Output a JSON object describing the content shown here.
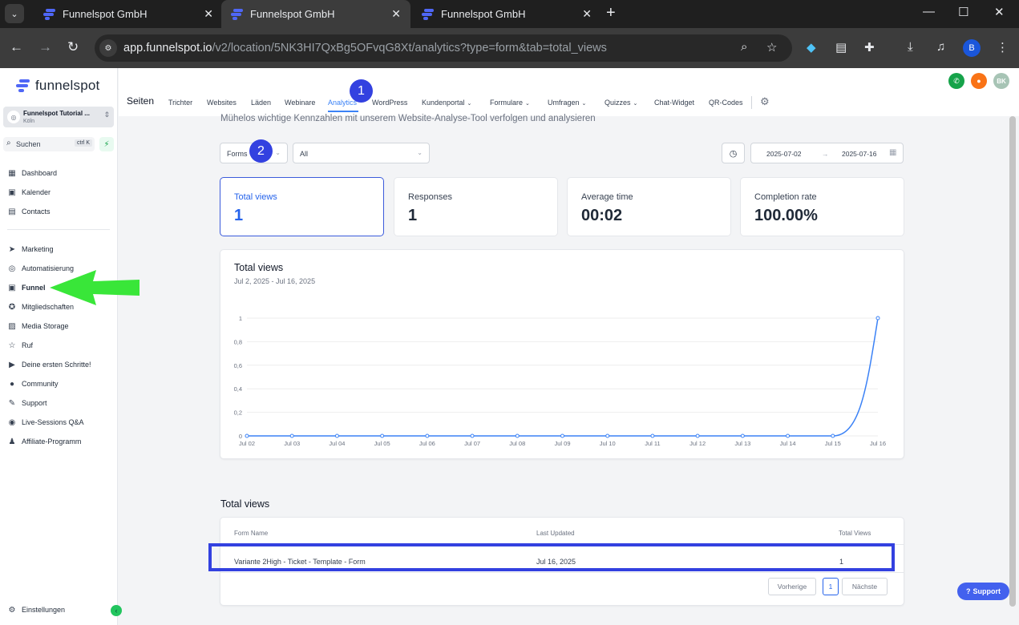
{
  "browser": {
    "tabs": [
      {
        "title": "Funnelspot GmbH",
        "active": false
      },
      {
        "title": "Funnelspot GmbH",
        "active": true
      },
      {
        "title": "Funnelspot GmbH",
        "active": false
      }
    ],
    "url_host": "app.funnelspot.io",
    "url_path": "/v2/location/5NK3HI7QxBg5OFvqG8Xt/analytics?type=form&tab=total_views",
    "profile_initial": "B"
  },
  "sidebar": {
    "brand": "funnelspot",
    "account_name": "Funnelspot Tutorial ...",
    "account_city": "Köln",
    "search_placeholder": "Suchen",
    "search_shortcut": "ctrl K",
    "items_top": [
      {
        "label": "Dashboard",
        "icon": "dashboard-icon",
        "glyph": "▦"
      },
      {
        "label": "Kalender",
        "icon": "calendar-icon",
        "glyph": "▣"
      },
      {
        "label": "Contacts",
        "icon": "contacts-icon",
        "glyph": "▤"
      }
    ],
    "items_main": [
      {
        "label": "Marketing",
        "icon": "send-icon",
        "glyph": "➤"
      },
      {
        "label": "Automatisierung",
        "icon": "automation-icon",
        "glyph": "◎"
      },
      {
        "label": "Funnel",
        "icon": "funnel-icon",
        "glyph": "▣",
        "active": true
      },
      {
        "label": "Mitgliedschaften",
        "icon": "membership-icon",
        "glyph": "✪"
      },
      {
        "label": "Media Storage",
        "icon": "media-icon",
        "glyph": "▨"
      },
      {
        "label": "Ruf",
        "icon": "star-icon",
        "glyph": "☆"
      },
      {
        "label": "Deine ersten Schritte!",
        "icon": "play-icon",
        "glyph": "▶"
      },
      {
        "label": "Community",
        "icon": "community-icon",
        "glyph": "●"
      },
      {
        "label": "Support",
        "icon": "wrench-icon",
        "glyph": "✎"
      },
      {
        "label": "Live-Sessions Q&A",
        "icon": "chat-icon",
        "glyph": "◉"
      },
      {
        "label": "Affiliate-Programm",
        "icon": "affiliate-icon",
        "glyph": "♟"
      }
    ],
    "settings_label": "Einstellungen"
  },
  "topnav": {
    "title": "Seiten",
    "tabs": [
      {
        "label": "Trichter",
        "dropdown": false
      },
      {
        "label": "Websites",
        "dropdown": false
      },
      {
        "label": "Läden",
        "dropdown": false
      },
      {
        "label": "Webinare",
        "dropdown": false
      },
      {
        "label": "Analytics",
        "dropdown": false,
        "active": true
      },
      {
        "label": "WordPress",
        "dropdown": false
      },
      {
        "label": "Kundenportal",
        "dropdown": true
      },
      {
        "label": "Formulare",
        "dropdown": true
      },
      {
        "label": "Umfragen",
        "dropdown": true
      },
      {
        "label": "Quizzes",
        "dropdown": true
      },
      {
        "label": "Chat-Widget",
        "dropdown": false
      },
      {
        "label": "QR-Codes",
        "dropdown": false
      }
    ],
    "user_initials": "BK"
  },
  "markers": [
    "1",
    "2"
  ],
  "analytics": {
    "subtitle": "Mühelos wichtige Kennzahlen mit unserem Website-Analyse-Tool verfolgen und analysieren",
    "type_select": "Forms",
    "filter_select": "All",
    "date_from": "2025-07-02",
    "date_to": "2025-07-16",
    "stats": [
      {
        "label": "Total views",
        "value": "1",
        "active": true
      },
      {
        "label": "Responses",
        "value": "1",
        "active": false
      },
      {
        "label": "Average time",
        "value": "00:02",
        "active": false
      },
      {
        "label": "Completion rate",
        "value": "100.00%",
        "active": false
      }
    ],
    "chart_title": "Total views",
    "chart_range": "Jul 2, 2025 - Jul 16, 2025",
    "table_title": "Total views",
    "table_headers": [
      "Form Name",
      "Last Updated",
      "Total Views"
    ],
    "table_rows": [
      {
        "name": "Variante 2High - Ticket - Template - Form",
        "updated": "Jul 16, 2025",
        "views": "1"
      }
    ],
    "pagination": {
      "prev": "Vorherige",
      "page": "1",
      "next": "Nächste"
    }
  },
  "support_button": "Support",
  "colors": {
    "accent": "#3b82f6",
    "brand": "#4f67f6",
    "marker": "#3341e0",
    "arrow": "#39e639"
  },
  "chart_data": {
    "type": "line",
    "title": "Total views",
    "subtitle": "Jul 2, 2025 - Jul 16, 2025",
    "categories": [
      "Jul 02",
      "Jul 03",
      "Jul 04",
      "Jul 05",
      "Jul 06",
      "Jul 07",
      "Jul 08",
      "Jul 09",
      "Jul 10",
      "Jul 11",
      "Jul 12",
      "Jul 13",
      "Jul 14",
      "Jul 15",
      "Jul 16"
    ],
    "series": [
      {
        "values": [
          0,
          0,
          0,
          0,
          0,
          0,
          0,
          0,
          0,
          0,
          0,
          0,
          0,
          0,
          1
        ]
      }
    ],
    "yticks": [
      "0",
      "0,2",
      "0,4",
      "0,6",
      "0,8",
      "1"
    ],
    "ylim": [
      0,
      1
    ],
    "grid": true,
    "color": "#3b82f6"
  }
}
